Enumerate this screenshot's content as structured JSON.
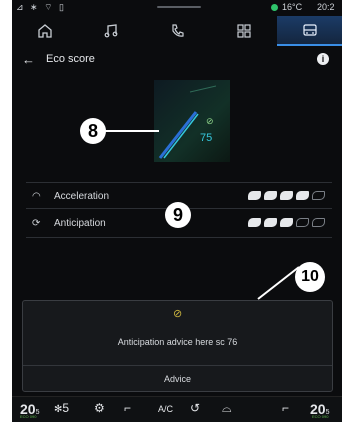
{
  "status": {
    "icons_left": "⊿ ∗ ⌔ ▯",
    "temperature": "16°C",
    "time": "20:2"
  },
  "tabs": [
    {
      "icon": "home-icon",
      "active": false
    },
    {
      "icon": "music-icon",
      "active": false
    },
    {
      "icon": "phone-icon",
      "active": false
    },
    {
      "icon": "apps-icon",
      "active": false
    },
    {
      "icon": "car-icon",
      "active": true
    }
  ],
  "header": {
    "back_icon": "←",
    "title": "Eco score",
    "info_label": "i"
  },
  "gauge": {
    "value": "75",
    "leaf": "⊘"
  },
  "callouts": {
    "c8": "8",
    "c9": "9",
    "c10": "10"
  },
  "metrics": [
    {
      "label": "Acceleration",
      "icon": "◠",
      "filled": 4,
      "total": 5
    },
    {
      "label": "Anticipation",
      "icon": "⟳",
      "filled": 3,
      "total": 5
    }
  ],
  "advice": {
    "icon": "⊘",
    "text": "Anticipation advice here sc 76",
    "button": "Advice"
  },
  "bottom": {
    "left_temp": "20",
    "left_temp_frac": "5",
    "fan": "5",
    "ac_label": "A/C",
    "right_temp": "20",
    "right_temp_frac": "5",
    "eco_label": "ECO 090"
  },
  "colors": {
    "active_tab": "#1b3b66",
    "gauge_value": "#35c7dd",
    "status_dot": "#2fc46b"
  }
}
